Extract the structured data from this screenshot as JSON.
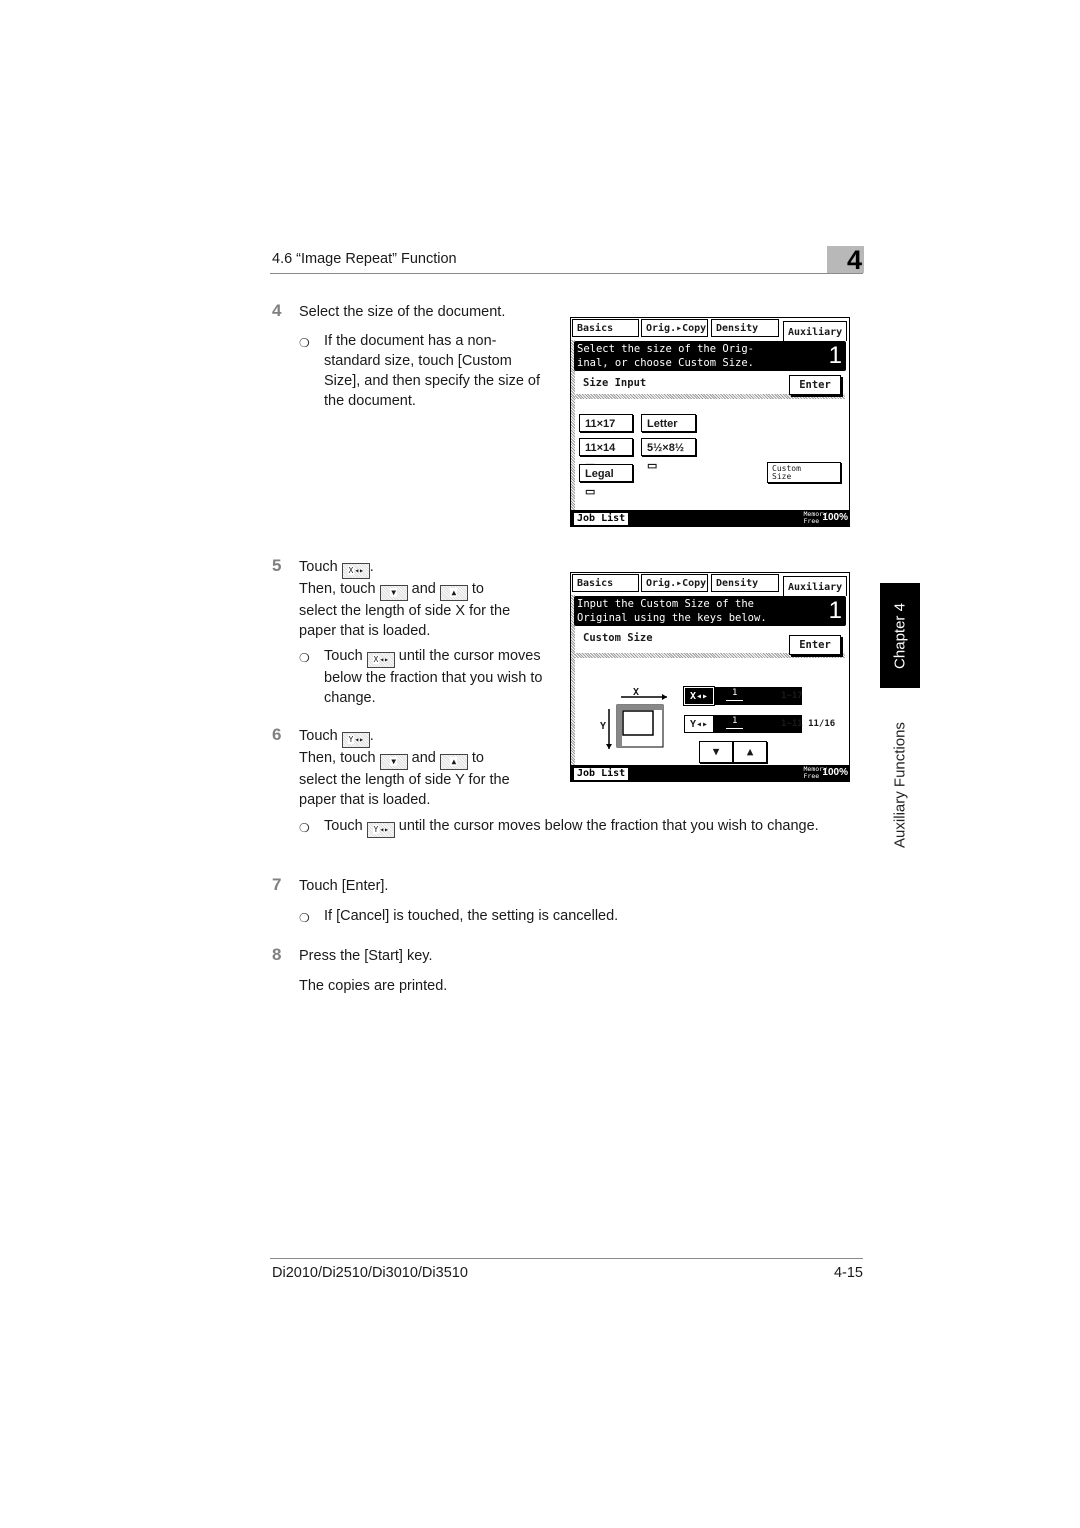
{
  "header": {
    "section_title": "4.6 “Image Repeat” Function",
    "chapter_number": "4"
  },
  "side_tab": {
    "chapter_label": "Chapter 4",
    "section_label": "Auxiliary Functions"
  },
  "steps": [
    {
      "number": "4",
      "text": "Select the size of the document.",
      "bullets": [
        "If the document has a non-standard size, touch [Custom Size], and then specify the size of the document."
      ]
    },
    {
      "number": "5",
      "line1_pre": "Touch",
      "line1_post": ".",
      "line2_pre": "Then, touch",
      "line2_mid": "and",
      "line2_post": "to",
      "text_rest": "select the length of side X for the paper that is loaded.",
      "bullet_pre": "Touch",
      "bullet_post": "until the cursor moves below the fraction that you wish to change."
    },
    {
      "number": "6",
      "line1_pre": "Touch",
      "line1_post": ".",
      "line2_pre": "Then, touch",
      "line2_mid": "and",
      "line2_post": "to",
      "text_rest": "select the length of side Y for the paper that is loaded.",
      "bullet_pre": "Touch",
      "bullet_post": "until the cursor moves below the fraction that you wish to change."
    },
    {
      "number": "7",
      "text": "Touch [Enter].",
      "bullets": [
        "If [Cancel] is touched, the setting is cancelled."
      ]
    },
    {
      "number": "8",
      "text": "Press the [Start] key.",
      "note": "The copies are printed."
    }
  ],
  "inline_keys": {
    "x_key": "X",
    "y_key": "Y",
    "down": "▼",
    "up": "▲"
  },
  "screen1": {
    "tabs": [
      "Basics",
      "Orig.▸Copy",
      "Density",
      "Auxiliary"
    ],
    "active_tab": "Auxiliary",
    "message_line1": "Select the size of the Orig-",
    "message_line2": "inal, or choose Custom Size.",
    "message_number": "1",
    "subtitle": "Size Input",
    "enter_label": "Enter",
    "size_buttons": [
      "11×17",
      "Letter",
      "11×14",
      "5½×8½",
      "Legal"
    ],
    "custom_size_line1": "Custom",
    "custom_size_line2": "Size",
    "job_list": "Job List",
    "memory_line1": "Memory",
    "memory_line2": "Free",
    "memory_value": "100%"
  },
  "screen2": {
    "tabs": [
      "Basics",
      "Orig.▸Copy",
      "Density",
      "Auxiliary"
    ],
    "active_tab": "Auxiliary",
    "message_line1": "Input the Custom Size of the",
    "message_line2": "Original using the keys below.",
    "message_number": "1",
    "subtitle": "Custom Size",
    "enter_label": "Enter",
    "diagram_x": "X",
    "diagram_y": "Y",
    "x_key": "X◂▸",
    "y_key": "Y◂▸",
    "x_value": "1",
    "y_value": "1",
    "x_range": "1~17",
    "y_range": "1~11 11/16",
    "down_label": "▼",
    "up_label": "▲",
    "job_list": "Job List",
    "memory_line1": "Memory",
    "memory_line2": "Free",
    "memory_value": "100%"
  },
  "footer": {
    "models": "Di2010/Di2510/Di3010/Di3510",
    "page": "4-15"
  }
}
